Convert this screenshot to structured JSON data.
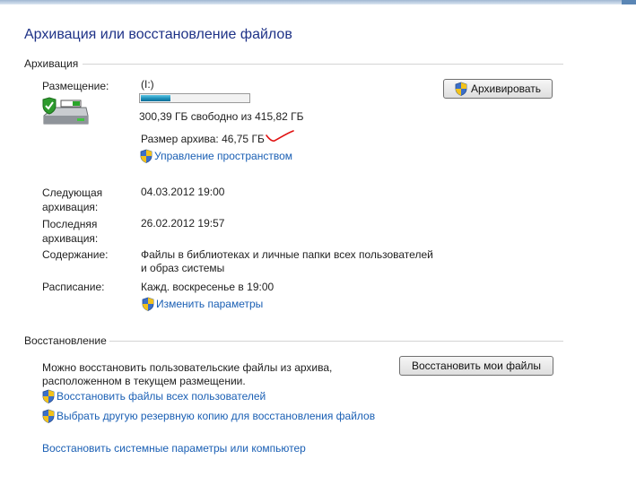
{
  "page": {
    "title": "Архивация или восстановление файлов"
  },
  "backup": {
    "section_title": "Архивация",
    "location_label": "Размещение:",
    "drive_name": "(I:)",
    "disk_used_fraction": 0.278,
    "free_space_text": "300,39 ГБ свободно из 415,82 ГБ",
    "archive_size_text": "Размер архива: 46,75 ГБ",
    "manage_space_link": "Управление пространством",
    "backup_button": "Архивировать",
    "next_label": "Следующая архивация:",
    "next_value": "04.03.2012 19:00",
    "last_label": "Последняя архивация:",
    "last_value": "26.02.2012 19:57",
    "contents_label": "Содержание:",
    "contents_value_line1": "Файлы в библиотеках и личные папки всех пользователей",
    "contents_value_line2": "и образ системы",
    "schedule_label": "Расписание:",
    "schedule_value": "Кажд. воскресенье в 19:00",
    "change_settings_link": "Изменить параметры"
  },
  "restore": {
    "section_title": "Восстановление",
    "description_line1": "Можно восстановить пользовательские файлы из архива,",
    "description_line2": "расположенном в текущем размещении.",
    "restore_my_files_button": "Восстановить мои файлы",
    "restore_all_users_link": "Восстановить файлы всех пользователей",
    "select_another_backup_link": "Выбрать другую резервную копию для восстановления файлов",
    "restore_system_link": "Восстановить системные параметры или компьютер"
  },
  "colors": {
    "link": "#1a5fb4",
    "title": "#1e3287",
    "progress_fill": "#1d8fb8",
    "annotation_check": "#e01010"
  },
  "icons": {
    "drive": "backup-drive-icon",
    "shield": "uac-shield-icon"
  }
}
